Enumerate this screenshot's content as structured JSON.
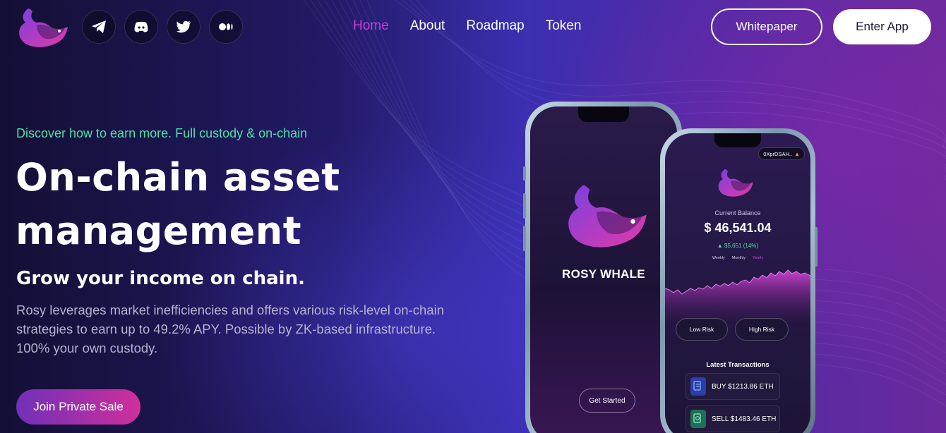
{
  "header": {
    "logo_icon": "whale-logo-icon",
    "socials": [
      {
        "name": "telegram-icon"
      },
      {
        "name": "discord-icon"
      },
      {
        "name": "twitter-icon"
      },
      {
        "name": "medium-icon"
      }
    ],
    "nav": [
      "Home",
      "About",
      "Roadmap",
      "Token"
    ],
    "nav_active": "Home",
    "whitepaper_label": "Whitepaper",
    "enter_app_label": "Enter App"
  },
  "hero": {
    "tagline": "Discover how to earn more. Full custody & on-chain",
    "headline_line1": "On-chain asset",
    "headline_line2": "management",
    "subheadline": "Grow your income on chain.",
    "description": "Rosy leverages market inefficiencies and offers various risk-level on-chain strategies to earn up to 49.2% APY. Possible by ZK-based infrastructure. 100% your own custody.",
    "cta_label": "Join Private Sale"
  },
  "phone_left": {
    "brand": "ROSY WHALE",
    "button_label": "Get Started"
  },
  "phone_right": {
    "wallet": "0XprDSAH..",
    "balance_label": "Current Balance",
    "balance_value": "$ 46,541.04",
    "balance_change": "▲ $5,651 (14%)",
    "periods": [
      "Weekly",
      "Monthly",
      "Yearly"
    ],
    "active_period": "Yearly",
    "risk_low": "Low Risk",
    "risk_high": "High Risk",
    "transactions_title": "Latest Transactions",
    "transactions": [
      {
        "label": "BUY $1213.86 ETH",
        "icon": "buy-icon"
      },
      {
        "label": "SELL $1483.46 ETH",
        "icon": "sell-icon"
      }
    ]
  },
  "colors": {
    "accent_pink": "#c23fd6",
    "accent_green": "#4fe0a6",
    "cta_gradient_start": "#7030b8",
    "cta_gradient_end": "#d02f9c"
  }
}
